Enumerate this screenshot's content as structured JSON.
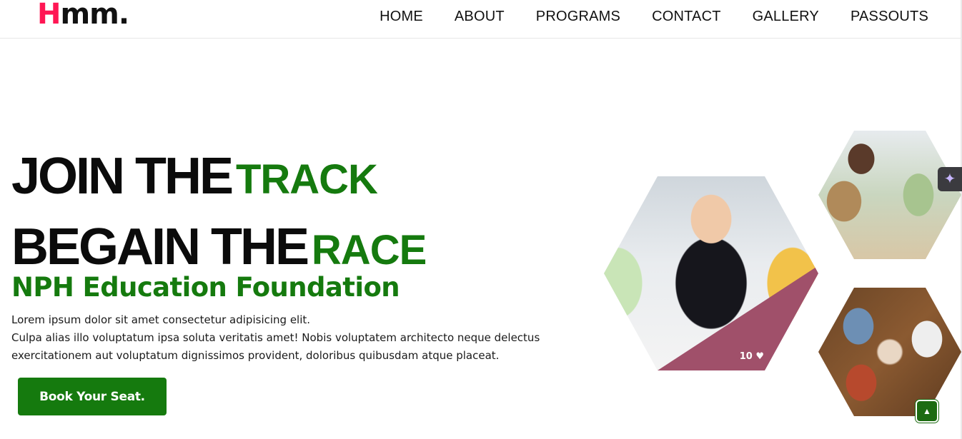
{
  "brand": {
    "logo_first": "H",
    "logo_rest": "mm."
  },
  "nav": {
    "items": [
      "HOME",
      "ABOUT",
      "PROGRAMS",
      "CONTACT",
      "GALLERY",
      "PASSOUTS"
    ]
  },
  "hero": {
    "line1_big": "JOIN THE",
    "line1_accent": "TRACK",
    "line2_big": "BEGAIN THE",
    "line2_accent": "RACE",
    "subtitle": "NPH Education Foundation",
    "description_line1": "Lorem ipsum dolor sit amet consectetur adipisicing elit.",
    "description_line2": "Culpa alias illo voluptatum ipsa soluta veritatis amet! Nobis voluptatem architecto neque delectus",
    "description_line3": "exercitationem aut voluptatum dignissimos provident, doloribus quibusdam atque placeat.",
    "cta_label": "Book Your Seat."
  },
  "gallery": {
    "main_likes": "10 ♥"
  },
  "colors": {
    "brand_pink": "#ff1654",
    "accent_green": "#157a0e",
    "overlay_mauve": "#a0506a"
  },
  "icons": {
    "sparkle": "✦",
    "scroll_top": "▲"
  }
}
